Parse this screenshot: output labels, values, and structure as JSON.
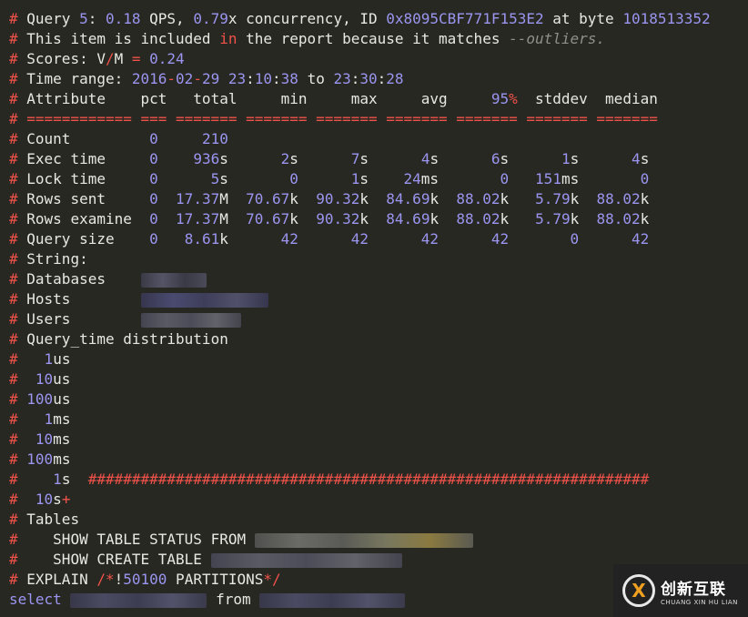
{
  "logo": {
    "mark": "X",
    "cn": "创新互联",
    "en": "CHUANG XIN HU LIAN"
  },
  "lines": [
    [
      [
        "hash",
        "#"
      ],
      [
        "t",
        " Query "
      ],
      [
        "num",
        "5"
      ],
      [
        "t",
        ": "
      ],
      [
        "num",
        "0.18"
      ],
      [
        "t",
        " QPS, "
      ],
      [
        "num",
        "0.79"
      ],
      [
        "t",
        "x concurrency, ID "
      ],
      [
        "num",
        "0x8095CBF771F153E2"
      ],
      [
        "t",
        " at byte "
      ],
      [
        "num",
        "1018513352"
      ]
    ],
    [
      [
        "hash",
        "#"
      ],
      [
        "t",
        " This item is included "
      ],
      [
        "kw",
        "in"
      ],
      [
        "t",
        " the report because it matches "
      ],
      [
        "cmt",
        "--outliers."
      ]
    ],
    [
      [
        "hash",
        "#"
      ],
      [
        "t",
        " Scores: V"
      ],
      [
        "kw",
        "/"
      ],
      [
        "t",
        "M "
      ],
      [
        "kw",
        "="
      ],
      [
        "t",
        " "
      ],
      [
        "num",
        "0.24"
      ]
    ],
    [
      [
        "hash",
        "#"
      ],
      [
        "t",
        " Time range: "
      ],
      [
        "num",
        "2016"
      ],
      [
        "kw",
        "-"
      ],
      [
        "num",
        "02"
      ],
      [
        "kw",
        "-"
      ],
      [
        "num",
        "29"
      ],
      [
        "t",
        " "
      ],
      [
        "num",
        "23"
      ],
      [
        "t",
        ":"
      ],
      [
        "num",
        "10"
      ],
      [
        "t",
        ":"
      ],
      [
        "num",
        "38"
      ],
      [
        "t",
        " to "
      ],
      [
        "num",
        "23"
      ],
      [
        "t",
        ":"
      ],
      [
        "num",
        "30"
      ],
      [
        "t",
        ":"
      ],
      [
        "num",
        "28"
      ]
    ],
    [
      [
        "hash",
        "#"
      ],
      [
        "t",
        " Attribute    pct   total     min     max     avg     "
      ],
      [
        "num",
        "95"
      ],
      [
        "kw",
        "%"
      ],
      [
        "t",
        "  stddev  median"
      ]
    ],
    [
      [
        "hash",
        "# ============ === ======= ======= ======= ======= ======= ======= ======="
      ]
    ],
    [
      [
        "hash",
        "#"
      ],
      [
        "t",
        " Count         "
      ],
      [
        "num",
        "0"
      ],
      [
        "t",
        "     "
      ],
      [
        "num",
        "210"
      ]
    ],
    [
      [
        "hash",
        "#"
      ],
      [
        "t",
        " Exec time     "
      ],
      [
        "num",
        "0"
      ],
      [
        "t",
        "    "
      ],
      [
        "num",
        "936"
      ],
      [
        "t",
        "s      "
      ],
      [
        "num",
        "2"
      ],
      [
        "t",
        "s      "
      ],
      [
        "num",
        "7"
      ],
      [
        "t",
        "s      "
      ],
      [
        "num",
        "4"
      ],
      [
        "t",
        "s      "
      ],
      [
        "num",
        "6"
      ],
      [
        "t",
        "s      "
      ],
      [
        "num",
        "1"
      ],
      [
        "t",
        "s      "
      ],
      [
        "num",
        "4"
      ],
      [
        "t",
        "s"
      ]
    ],
    [
      [
        "hash",
        "#"
      ],
      [
        "t",
        " Lock time     "
      ],
      [
        "num",
        "0"
      ],
      [
        "t",
        "      "
      ],
      [
        "num",
        "5"
      ],
      [
        "t",
        "s       "
      ],
      [
        "num",
        "0"
      ],
      [
        "t",
        "      "
      ],
      [
        "num",
        "1"
      ],
      [
        "t",
        "s    "
      ],
      [
        "num",
        "24"
      ],
      [
        "t",
        "ms       "
      ],
      [
        "num",
        "0"
      ],
      [
        "t",
        "   "
      ],
      [
        "num",
        "151"
      ],
      [
        "t",
        "ms       "
      ],
      [
        "num",
        "0"
      ]
    ],
    [
      [
        "hash",
        "#"
      ],
      [
        "t",
        " Rows sent     "
      ],
      [
        "num",
        "0"
      ],
      [
        "t",
        "  "
      ],
      [
        "num",
        "17.37"
      ],
      [
        "t",
        "M  "
      ],
      [
        "num",
        "70.67"
      ],
      [
        "t",
        "k  "
      ],
      [
        "num",
        "90.32"
      ],
      [
        "t",
        "k  "
      ],
      [
        "num",
        "84.69"
      ],
      [
        "t",
        "k  "
      ],
      [
        "num",
        "88.02"
      ],
      [
        "t",
        "k   "
      ],
      [
        "num",
        "5.79"
      ],
      [
        "t",
        "k  "
      ],
      [
        "num",
        "88.02"
      ],
      [
        "t",
        "k"
      ]
    ],
    [
      [
        "hash",
        "#"
      ],
      [
        "t",
        " Rows examine  "
      ],
      [
        "num",
        "0"
      ],
      [
        "t",
        "  "
      ],
      [
        "num",
        "17.37"
      ],
      [
        "t",
        "M  "
      ],
      [
        "num",
        "70.67"
      ],
      [
        "t",
        "k  "
      ],
      [
        "num",
        "90.32"
      ],
      [
        "t",
        "k  "
      ],
      [
        "num",
        "84.69"
      ],
      [
        "t",
        "k  "
      ],
      [
        "num",
        "88.02"
      ],
      [
        "t",
        "k   "
      ],
      [
        "num",
        "5.79"
      ],
      [
        "t",
        "k  "
      ],
      [
        "num",
        "88.02"
      ],
      [
        "t",
        "k"
      ]
    ],
    [
      [
        "hash",
        "#"
      ],
      [
        "t",
        " Query size    "
      ],
      [
        "num",
        "0"
      ],
      [
        "t",
        "   "
      ],
      [
        "num",
        "8.61"
      ],
      [
        "t",
        "k      "
      ],
      [
        "num",
        "42"
      ],
      [
        "t",
        "      "
      ],
      [
        "num",
        "42"
      ],
      [
        "t",
        "      "
      ],
      [
        "num",
        "42"
      ],
      [
        "t",
        "      "
      ],
      [
        "num",
        "42"
      ],
      [
        "t",
        "       "
      ],
      [
        "num",
        "0"
      ],
      [
        "t",
        "      "
      ],
      [
        "num",
        "42"
      ]
    ],
    [
      [
        "hash",
        "#"
      ],
      [
        "t",
        " String:"
      ]
    ],
    [
      [
        "hash",
        "#"
      ],
      [
        "t",
        " Databases    "
      ],
      [
        "blur",
        "b1:72"
      ]
    ],
    [
      [
        "hash",
        "#"
      ],
      [
        "t",
        " Hosts        "
      ],
      [
        "blur",
        "b2:140"
      ]
    ],
    [
      [
        "hash",
        "#"
      ],
      [
        "t",
        " Users        "
      ],
      [
        "blur",
        "b4:110"
      ]
    ],
    [
      [
        "hash",
        "#"
      ],
      [
        "t",
        " Query_time distribution"
      ]
    ],
    [
      [
        "hash",
        "#"
      ],
      [
        "t",
        "   "
      ],
      [
        "num",
        "1"
      ],
      [
        "t",
        "us"
      ]
    ],
    [
      [
        "hash",
        "#"
      ],
      [
        "t",
        "  "
      ],
      [
        "num",
        "10"
      ],
      [
        "t",
        "us"
      ]
    ],
    [
      [
        "hash",
        "#"
      ],
      [
        "t",
        " "
      ],
      [
        "num",
        "100"
      ],
      [
        "t",
        "us"
      ]
    ],
    [
      [
        "hash",
        "#"
      ],
      [
        "t",
        "   "
      ],
      [
        "num",
        "1"
      ],
      [
        "t",
        "ms"
      ]
    ],
    [
      [
        "hash",
        "#"
      ],
      [
        "t",
        "  "
      ],
      [
        "num",
        "10"
      ],
      [
        "t",
        "ms"
      ]
    ],
    [
      [
        "hash",
        "#"
      ],
      [
        "t",
        " "
      ],
      [
        "num",
        "100"
      ],
      [
        "t",
        "ms"
      ]
    ],
    [
      [
        "hash",
        "#"
      ],
      [
        "t",
        "    "
      ],
      [
        "num",
        "1"
      ],
      [
        "t",
        "s  "
      ],
      [
        "hash",
        "################################################################"
      ]
    ],
    [
      [
        "hash",
        "#"
      ],
      [
        "t",
        "  "
      ],
      [
        "num",
        "10"
      ],
      [
        "t",
        "s"
      ],
      [
        "kw",
        "+"
      ]
    ],
    [
      [
        "hash",
        "#"
      ],
      [
        "t",
        " Tables"
      ]
    ],
    [
      [
        "hash",
        "#"
      ],
      [
        "t",
        "    SHOW TABLE STATUS FROM "
      ],
      [
        "blur",
        "b3:240"
      ]
    ],
    [
      [
        "hash",
        "#"
      ],
      [
        "t",
        "    SHOW CREATE TABLE "
      ],
      [
        "blur",
        "b4:210"
      ]
    ],
    [
      [
        "hash",
        "#"
      ],
      [
        "t",
        " EXPLAIN "
      ],
      [
        "kw",
        "/*"
      ],
      [
        "t",
        "!"
      ],
      [
        "num",
        "50100"
      ],
      [
        "t",
        " PARTITIONS"
      ],
      [
        "kw",
        "*/"
      ]
    ],
    [
      [
        "num",
        "select"
      ],
      [
        "t",
        " "
      ],
      [
        "blur",
        "b5:150"
      ],
      [
        "t",
        " from "
      ],
      [
        "blur",
        "b5:160"
      ]
    ]
  ]
}
